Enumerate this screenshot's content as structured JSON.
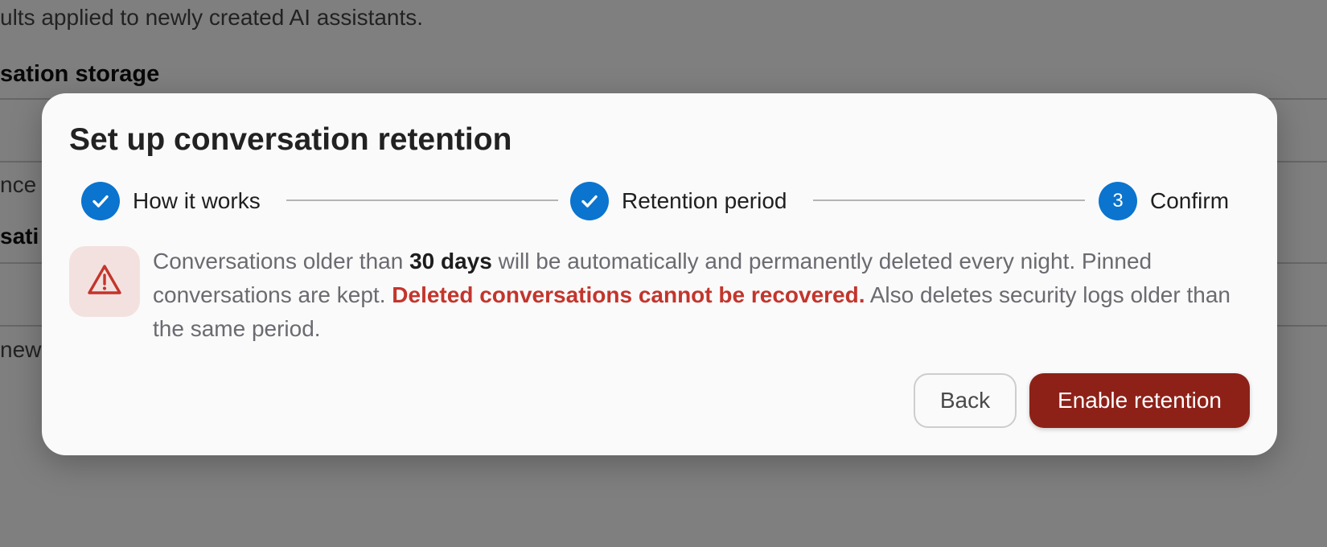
{
  "background": {
    "description_fragment": "ults applied to newly created AI assistants.",
    "section_heading_fragment": "sation storage",
    "row_fragment_1": "nce",
    "row_fragment_2": "sati",
    "row_fragment_3": "newl"
  },
  "modal": {
    "title": "Set up conversation retention",
    "steps": [
      {
        "label": "How it works",
        "state": "completed",
        "icon": "check-icon"
      },
      {
        "label": "Retention period",
        "state": "completed",
        "icon": "check-icon"
      },
      {
        "label": "Confirm",
        "state": "current",
        "number": "3"
      }
    ],
    "warning": {
      "icon": "warning-triangle-icon",
      "text_1": "Conversations older than ",
      "period": "30 days",
      "text_2": " will be automatically and permanently deleted every night. Pinned conversations are kept. ",
      "danger": "Deleted conversations cannot be recovered.",
      "text_3": " Also deletes security logs older than the same period."
    },
    "buttons": {
      "back": "Back",
      "enable": "Enable retention"
    }
  },
  "colors": {
    "accent": "#0a74cf",
    "danger_text": "#c3352c",
    "danger_button": "#8d2118",
    "warning_icon_bg": "#f3e1df"
  }
}
